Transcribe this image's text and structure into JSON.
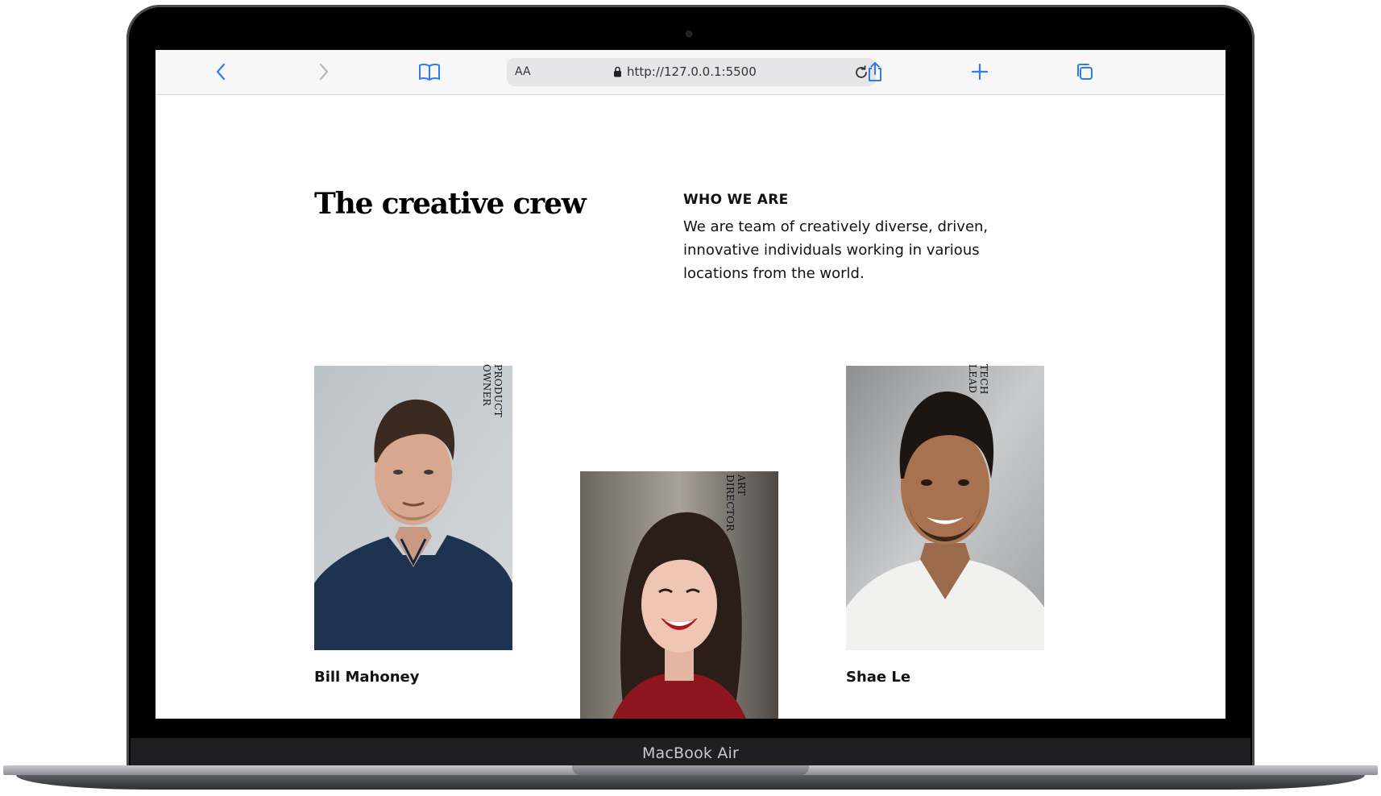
{
  "device": {
    "model_label": "MacBook Air"
  },
  "browser": {
    "text_size_label": "AA",
    "url": "http://127.0.0.1:5500",
    "icons": [
      "back-chevron-icon",
      "forward-chevron-icon",
      "bookmarks-book-icon",
      "lock-icon",
      "reload-icon",
      "share-icon",
      "new-tab-plus-icon",
      "tabs-overview-icon"
    ],
    "accent_color": "#2f7bf5"
  },
  "page": {
    "title": "The creative crew",
    "kicker": "WHO WE ARE",
    "lead": "We are team of creatively diverse, driven, innovative individuals working in various locations from the world.",
    "team": [
      {
        "name": "Bill Mahoney",
        "role": "PRODUCT OWNER",
        "photo_icon": "portrait-man-navy-polo"
      },
      {
        "name": "",
        "role": "ART DIRECTOR",
        "photo_icon": "portrait-woman-red-top"
      },
      {
        "name": "Shae Le",
        "role": "TECH LEAD",
        "photo_icon": "portrait-man-white-tee"
      }
    ]
  }
}
